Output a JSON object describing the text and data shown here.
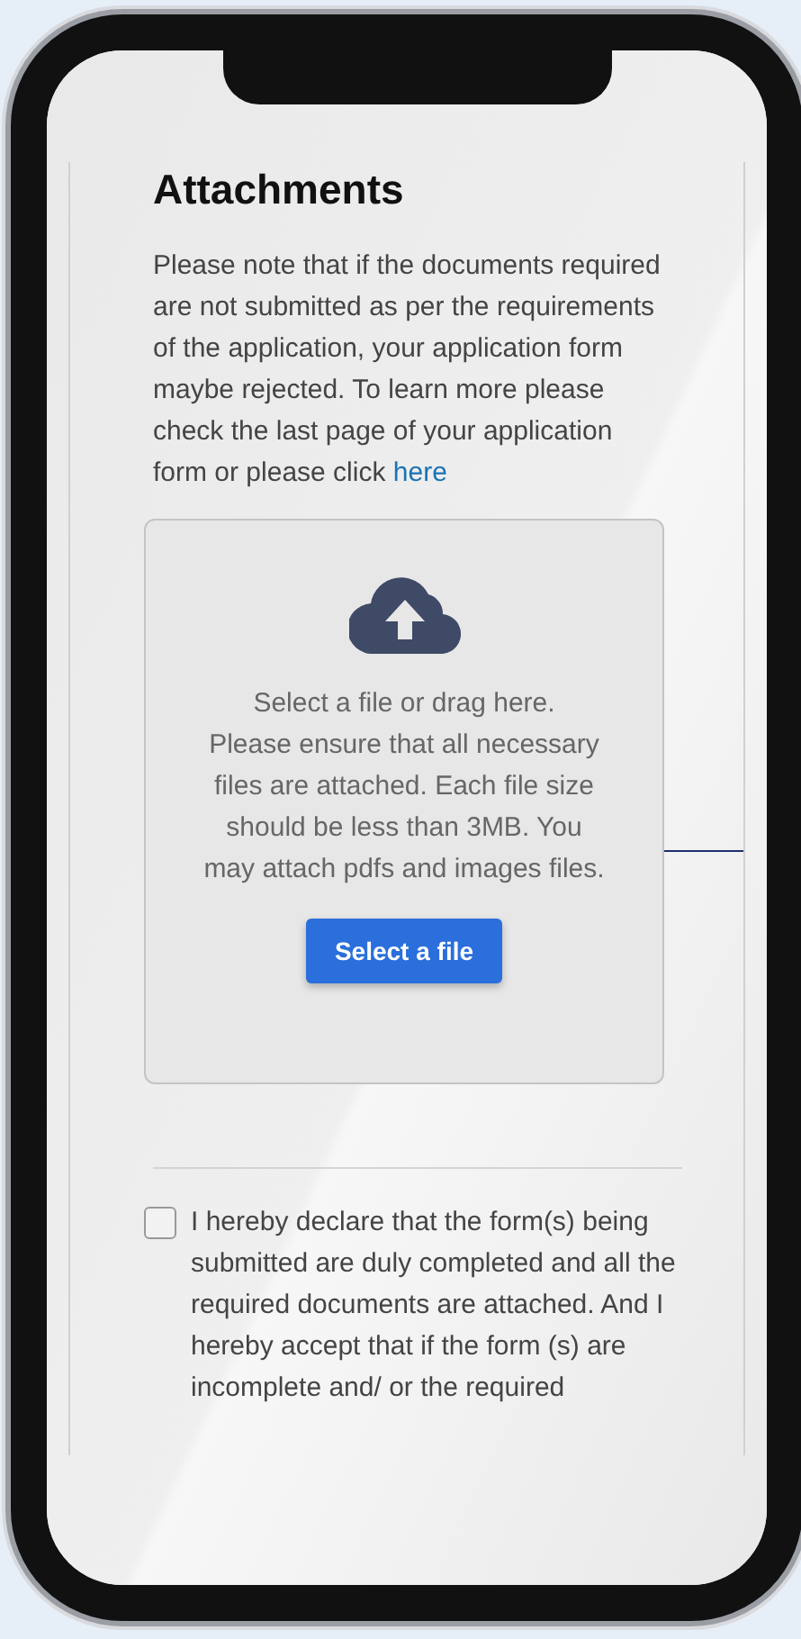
{
  "section": {
    "title": "Attachments"
  },
  "notice": {
    "text": "Please note that if the documents required are not submitted as per the requirements of the application, your application form maybe rejected. To learn more please check the last page of your application form or please click",
    "link": "here"
  },
  "upload": {
    "headline": "Select a file or drag here.",
    "details": "Please ensure that all necessary files are attached. Each file size should be less than 3MB. You may attach pdfs and images files.",
    "button": "Select a file"
  },
  "declaration": {
    "checked": false,
    "text": "I hereby declare that the form(s) being submitted are duly completed and all the required documents are attached. And I hereby accept that if the form (s) are incomplete and/ or the required"
  }
}
